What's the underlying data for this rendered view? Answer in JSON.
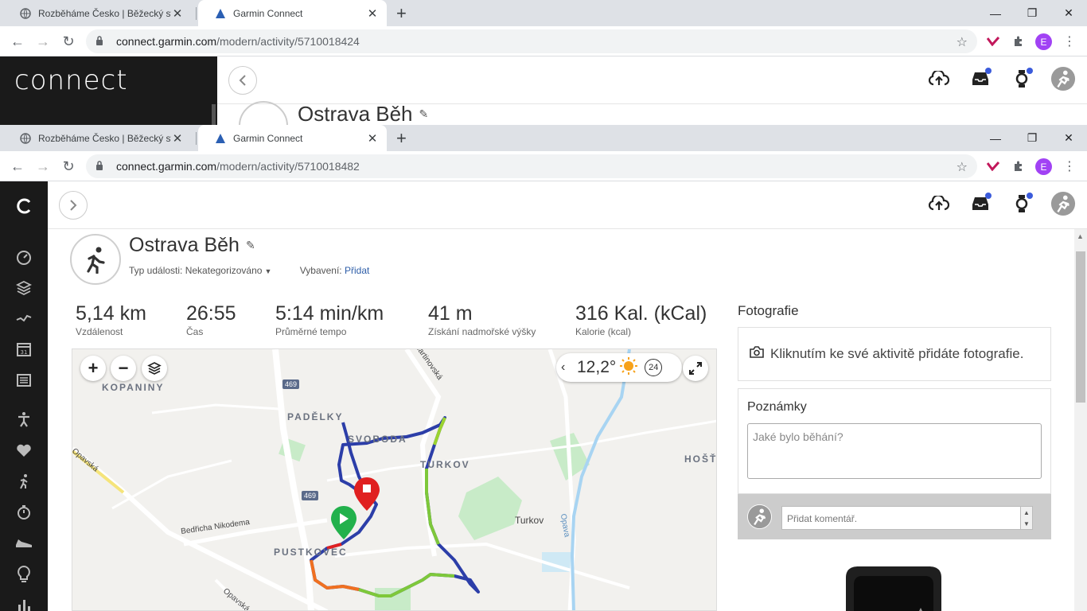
{
  "browser_back": {
    "tabs": [
      {
        "title": "Rozběháme Česko | Běžecký svět",
        "active": false
      },
      {
        "title": "Garmin Connect",
        "active": true
      }
    ],
    "url_host": "connect.garmin.com",
    "url_path": "/modern/activity/5710018424",
    "profile_initial": "E"
  },
  "browser_front": {
    "tabs": [
      {
        "title": "Rozběháme Česko | Běžecký svět",
        "active": false
      },
      {
        "title": "Garmin Connect",
        "active": true
      }
    ],
    "url_host": "connect.garmin.com",
    "url_path": "/modern/activity/5710018482",
    "profile_initial": "E"
  },
  "app_back": {
    "logo": "connect",
    "activity_title": "Ostrava Běh"
  },
  "activity": {
    "title": "Ostrava Běh",
    "event_type_label": "Typ události:",
    "event_type_value": "Nekategorizováno",
    "gear_label": "Vybavení:",
    "gear_link": "Přidat",
    "stats": [
      {
        "value": "5,14 km",
        "label": "Vzdálenost"
      },
      {
        "value": "26:55",
        "label": "Čas"
      },
      {
        "value": "5:14 min/km",
        "label": "Průměrné tempo"
      },
      {
        "value": "41 m",
        "label": "Získání nadmořské výšky"
      },
      {
        "value": "316 Kal. (kCal)",
        "label": "Kalorie (kcal)"
      }
    ]
  },
  "map": {
    "weather_temp": "12,2°",
    "weather_badge": "24",
    "labels": {
      "kopaniny": "KOPANINY",
      "padelky": "PADĚLKY",
      "svoboda": "SVOBODA",
      "turkov_caps": "TURKOV",
      "hosti": "HOŠŤ",
      "pustkovec": "PUSTKOVEC",
      "turkov_town": "Turkov",
      "opava_river": "Opava",
      "road_opavska_left": "Opavská",
      "road_opavska_bottom": "Opavská",
      "road_bedricha": "Bedřicha Nikodema",
      "road_martinovska": "Martinovská",
      "road_469_top": "469",
      "road_469_mid": "469"
    }
  },
  "photos": {
    "title": "Fotografie",
    "prompt": "Kliknutím ke své aktivitě přidáte fotografie."
  },
  "notes": {
    "title": "Poznámky",
    "placeholder": "Jaké bylo běhání?"
  },
  "comment": {
    "placeholder": "Přidat komentář."
  },
  "colors": {
    "sidebar": "#1a1a1a",
    "link": "#2e5ea8",
    "start_marker": "#22b14c",
    "end_marker": "#e02020",
    "notification_dot": "#3b5bdb"
  }
}
